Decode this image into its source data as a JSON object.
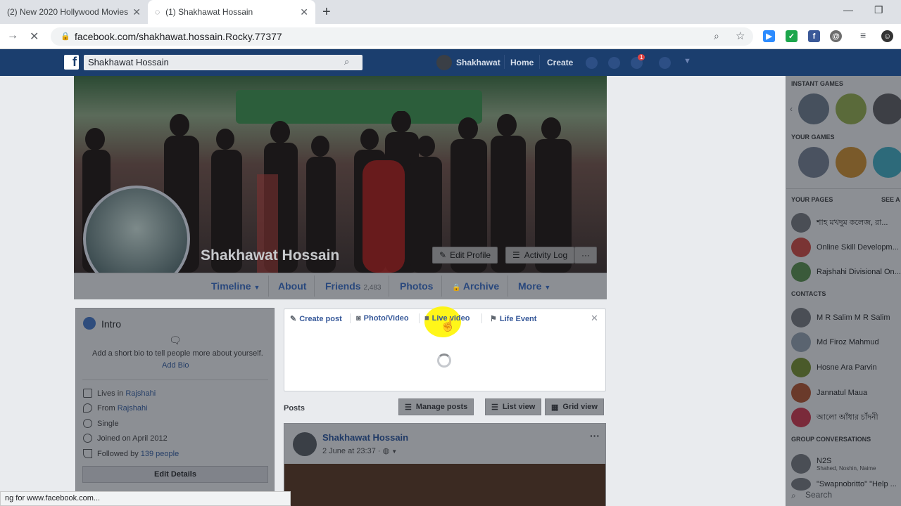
{
  "browser": {
    "tabs": [
      {
        "title": "(2) New 2020 Hollywood Movies"
      },
      {
        "title": "(1) Shakhawat Hossain"
      }
    ],
    "url": "facebook.com/shakhawat.hossain.Rocky.77377",
    "status": "ng for www.facebook.com..."
  },
  "fb_nav": {
    "search_value": "Shakhawat Hossain",
    "user": "Shakhawat",
    "home": "Home",
    "create": "Create",
    "notif_count": "1"
  },
  "profile": {
    "name": "Shakhawat Hossain",
    "edit_profile": "Edit Profile",
    "activity_log": "Activity Log",
    "more_dots": "···",
    "tabs": {
      "timeline": "Timeline",
      "about": "About",
      "friends": "Friends",
      "friends_count": "2,483",
      "photos": "Photos",
      "archive": "Archive",
      "more": "More"
    }
  },
  "intro": {
    "title": "Intro",
    "bio_prompt": "Add a short bio to tell people more about yourself.",
    "add_bio": "Add Bio",
    "lives_prefix": "Lives in ",
    "lives": "Rajshahi",
    "from_prefix": "From ",
    "from": "Rajshahi",
    "relationship": "Single",
    "joined": "Joined on April 2012",
    "followed_prefix": "Followed by ",
    "followed": "139 people",
    "edit_details": "Edit Details"
  },
  "composer": {
    "create_post": "Create post",
    "photo_video": "Photo/Video",
    "live_video": "Live video",
    "life_event": "Life Event"
  },
  "posts": {
    "label": "Posts",
    "manage": "Manage posts",
    "list_view": "List view",
    "grid_view": "Grid view",
    "first": {
      "author": "Shakhawat Hossain",
      "date": "2 June at 23:37 · "
    }
  },
  "sidebar": {
    "instant_games": "INSTANT GAMES",
    "your_games": "YOUR GAMES",
    "your_pages": "YOUR PAGES",
    "see_all": "SEE A",
    "pages": [
      "শাহ মখদুম কলেজ, রা...",
      "Online Skill Developm...",
      "Rajshahi Divisional On..."
    ],
    "contacts_label": "CONTACTS",
    "contacts": [
      "M R Salim M R Salim",
      "Md Firoz Mahmud",
      "Hosne Ara Parvin",
      "Jannatul Maua",
      "আলো আঁধার চাঁদনী"
    ],
    "group_label": "GROUP CONVERSATIONS",
    "groups": [
      {
        "name": "N2S",
        "sub": "Shahed, Noshin, Naime"
      },
      {
        "name": "\"Swapnobritto\" \"Help ...",
        "sub": ""
      }
    ],
    "search": "Search"
  }
}
